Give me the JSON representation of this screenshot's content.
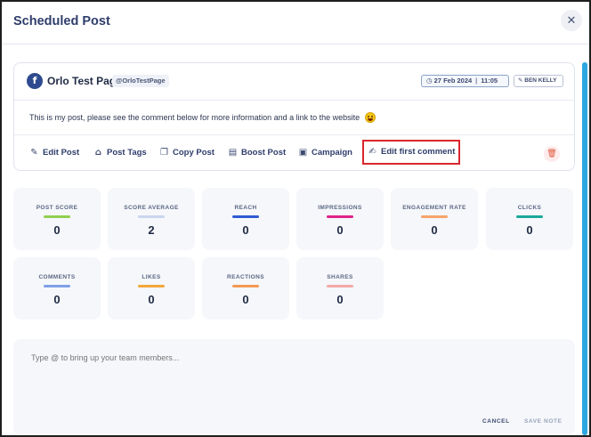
{
  "modal": {
    "title": "Scheduled Post",
    "close_label": "✕"
  },
  "post": {
    "network_icon": "facebook-icon",
    "network_glyph": "f",
    "page_name": "Orlo Test Page",
    "handle": "@OrloTestPage",
    "date": "27 Feb 2024",
    "time": "11:05",
    "author": "BEN KELLY",
    "body": "This is my post, please see the comment below for more information and a link to the website"
  },
  "actions": [
    {
      "icon": "edit-icon",
      "label": "Edit Post"
    },
    {
      "icon": "tag-icon",
      "label": "Post Tags"
    },
    {
      "icon": "copy-icon",
      "label": "Copy Post"
    },
    {
      "icon": "boost-icon",
      "label": "Boost Post"
    },
    {
      "icon": "campaign-icon",
      "label": "Campaign"
    },
    {
      "icon": "comment-edit-icon",
      "label": "Edit first comment"
    }
  ],
  "metrics": [
    {
      "label": "POST SCORE",
      "value": "0",
      "color": "#8fd14f"
    },
    {
      "label": "SCORE AVERAGE",
      "value": "2",
      "color": "#c9d6ee"
    },
    {
      "label": "REACH",
      "value": "0",
      "color": "#2f5bd3"
    },
    {
      "label": "IMPRESSIONS",
      "value": "0",
      "color": "#e0248a"
    },
    {
      "label": "ENGAGEMENT RATE",
      "value": "0",
      "color": "#f7a46a"
    },
    {
      "label": "CLICKS",
      "value": "0",
      "color": "#1aa89a"
    },
    {
      "label": "COMMENTS",
      "value": "0",
      "color": "#7fa0e6"
    },
    {
      "label": "LIKES",
      "value": "0",
      "color": "#f3a73c"
    },
    {
      "label": "REACTIONS",
      "value": "0",
      "color": "#f29a55"
    },
    {
      "label": "SHARES",
      "value": "0",
      "color": "#f2a9a6"
    }
  ],
  "notes": {
    "placeholder": "Type @ to bring up your team members...",
    "cancel_label": "CANCEL",
    "save_label": "SAVE NOTE"
  },
  "colors": {
    "accent": "#2f3d6b",
    "highlight_border": "#d9262c",
    "scrollbar": "#2ea7e0"
  }
}
